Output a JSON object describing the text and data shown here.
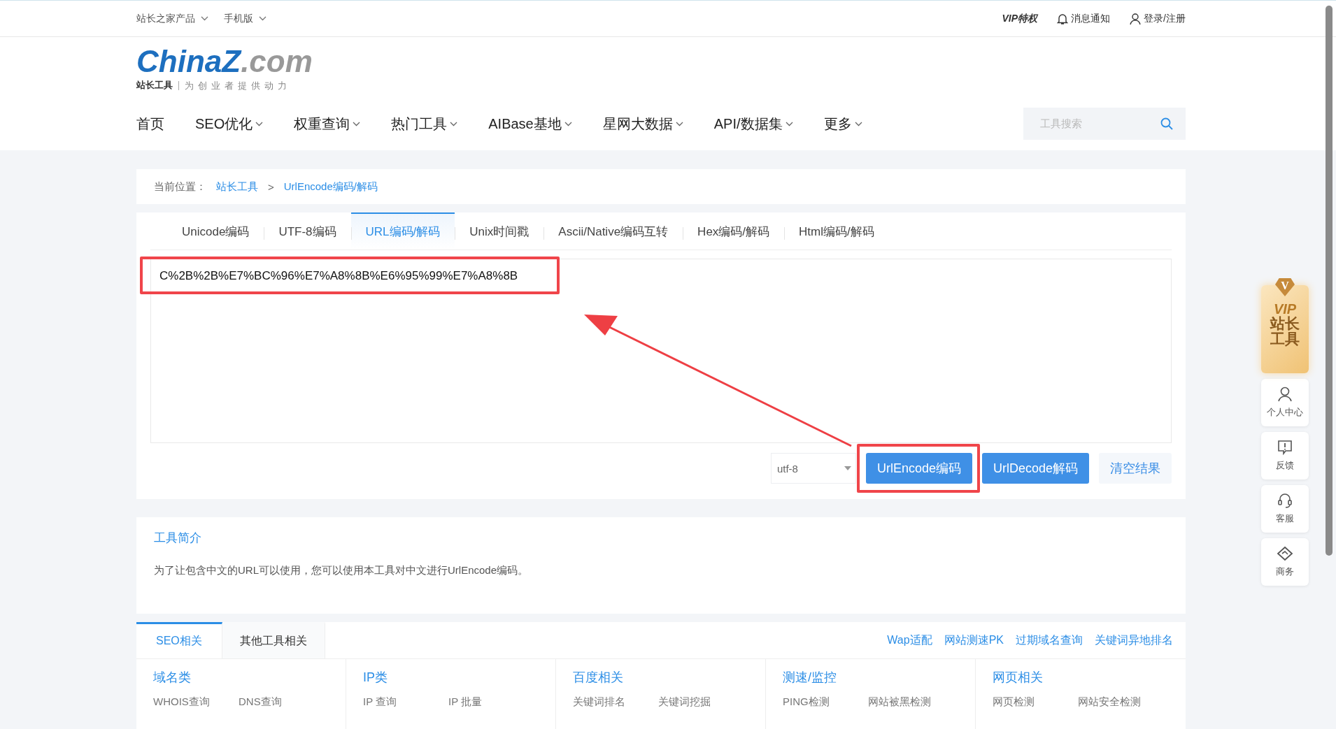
{
  "top_bar": {
    "left": [
      {
        "label": "站长之家产品",
        "dropdown": true
      },
      {
        "label": "手机版",
        "dropdown": true
      }
    ],
    "right": [
      {
        "kind": "vip",
        "label": "VIP特权"
      },
      {
        "kind": "bell",
        "label": "消息通知"
      },
      {
        "kind": "user",
        "label": "登录/注册"
      }
    ]
  },
  "logo": {
    "name_parts": [
      "China",
      "Z",
      ".com"
    ],
    "brand": "站长工具",
    "slogan": "为创业者提供动力"
  },
  "nav": {
    "items": [
      {
        "label": "首页",
        "dropdown": false
      },
      {
        "label": "SEO优化",
        "dropdown": true
      },
      {
        "label": "权重查询",
        "dropdown": true
      },
      {
        "label": "热门工具",
        "dropdown": true
      },
      {
        "label": "AIBase基地",
        "dropdown": true
      },
      {
        "label": "星网大数据",
        "dropdown": true
      },
      {
        "label": "API/数据集",
        "dropdown": true
      },
      {
        "label": "更多",
        "dropdown": true
      }
    ],
    "search": {
      "placeholder": "工具搜索"
    }
  },
  "breadcrumb": {
    "prefix": "当前位置：",
    "items": [
      "站长工具",
      "UrlEncode编码/解码"
    ],
    "separator": ">"
  },
  "tabs": [
    {
      "label": "Unicode编码",
      "selected": false
    },
    {
      "label": "UTF-8编码",
      "selected": false
    },
    {
      "label": "URL编码/解码",
      "selected": true
    },
    {
      "label": "Unix时间戳",
      "selected": false
    },
    {
      "label": "Ascii/Native编码互转",
      "selected": false
    },
    {
      "label": "Hex编码/解码",
      "selected": false
    },
    {
      "label": "Html编码/解码",
      "selected": false
    }
  ],
  "input": {
    "value": "C%2B%2B%E7%BC%96%E7%A8%8B%E6%95%99%E7%A8%8B",
    "highlighted": true
  },
  "charset": {
    "value": "utf-8"
  },
  "buttons": [
    {
      "kind": "primary",
      "label": "UrlEncode编码",
      "highlighted": true
    },
    {
      "kind": "primary",
      "label": "UrlDecode解码",
      "highlighted": false
    },
    {
      "kind": "light",
      "label": "清空结果",
      "highlighted": false
    }
  ],
  "annotation_arrow": true,
  "intro": {
    "title": "工具简介",
    "text": "为了让包含中文的URL可以使用，您可以使用本工具对中文进行UrlEncode编码。"
  },
  "related": {
    "tabs": [
      {
        "label": "SEO相关",
        "selected": true
      },
      {
        "label": "其他工具相关",
        "selected": false
      }
    ],
    "links": [
      "Wap适配",
      "网站测速PK",
      "过期域名查询",
      "关键词异地排名"
    ],
    "columns": [
      {
        "title": "域名类",
        "items": [
          "WHOIS查询",
          "DNS查询"
        ]
      },
      {
        "title": "IP类",
        "items": [
          "IP 查询",
          "IP 批量"
        ]
      },
      {
        "title": "百度相关",
        "items": [
          "关键词排名",
          "关键词挖掘"
        ]
      },
      {
        "title": "测速/监控",
        "items": [
          "PING检测",
          "网站被黑检测"
        ]
      },
      {
        "title": "网页相关",
        "items": [
          "网页检测",
          "网站安全检测"
        ]
      }
    ]
  },
  "side_float": {
    "vip": {
      "badge": "V",
      "label": "VIP",
      "title": "站长工具"
    },
    "items": [
      {
        "kind": "user",
        "label": "个人中心"
      },
      {
        "kind": "feedback",
        "label": "反馈"
      },
      {
        "kind": "headset",
        "label": "客服"
      },
      {
        "kind": "handshake",
        "label": "商务"
      }
    ]
  }
}
